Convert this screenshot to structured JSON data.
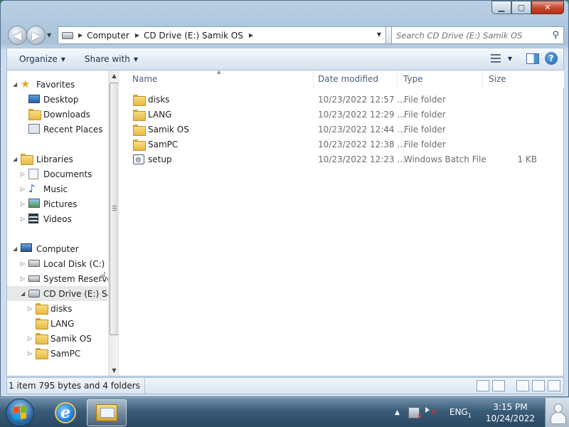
{
  "window": {
    "caption": {
      "minimize": "▁",
      "maximize": "▢",
      "close": "✕"
    }
  },
  "address": {
    "crumbs": [
      "Computer",
      "CD Drive (E:) Samik OS"
    ],
    "search_placeholder": "Search CD Drive (E:) Samik OS"
  },
  "toolbar": {
    "organize_label": "Organize",
    "share_label": "Share with"
  },
  "nav": {
    "favorites": {
      "label": "Favorites",
      "items": [
        "Desktop",
        "Downloads",
        "Recent Places"
      ]
    },
    "libraries": {
      "label": "Libraries",
      "items": [
        "Documents",
        "Music",
        "Pictures",
        "Videos"
      ]
    },
    "computer": {
      "label": "Computer",
      "items": [
        "Local Disk (C:)",
        "System Reserved",
        "CD Drive (E:) Samik OS"
      ]
    },
    "cd_children": [
      "disks",
      "LANG",
      "Samik OS",
      "SamPC"
    ]
  },
  "columns": {
    "name": "Name",
    "date": "Date modified",
    "type": "Type",
    "size": "Size"
  },
  "files": [
    {
      "name": "disks",
      "date": "10/23/2022 12:57 ...",
      "type": "File folder",
      "size": "",
      "icon": "folder-icon"
    },
    {
      "name": "LANG",
      "date": "10/23/2022 12:29 ...",
      "type": "File folder",
      "size": "",
      "icon": "folder-icon"
    },
    {
      "name": "Samik OS",
      "date": "10/23/2022 12:44 ...",
      "type": "File folder",
      "size": "",
      "icon": "folder-icon"
    },
    {
      "name": "SamPC",
      "date": "10/23/2022 12:38 ...",
      "type": "File folder",
      "size": "",
      "icon": "folder-icon"
    },
    {
      "name": "setup",
      "date": "10/23/2022 12:23 ...",
      "type": "Windows Batch File",
      "size": "1 KB",
      "icon": "batch-file-icon"
    }
  ],
  "status": {
    "text": "1 item 795 bytes and 4 folders"
  },
  "taskbar": {
    "lang": "ENG",
    "lang_sub": "1",
    "time": "3:15 PM",
    "date": "10/24/2022"
  }
}
